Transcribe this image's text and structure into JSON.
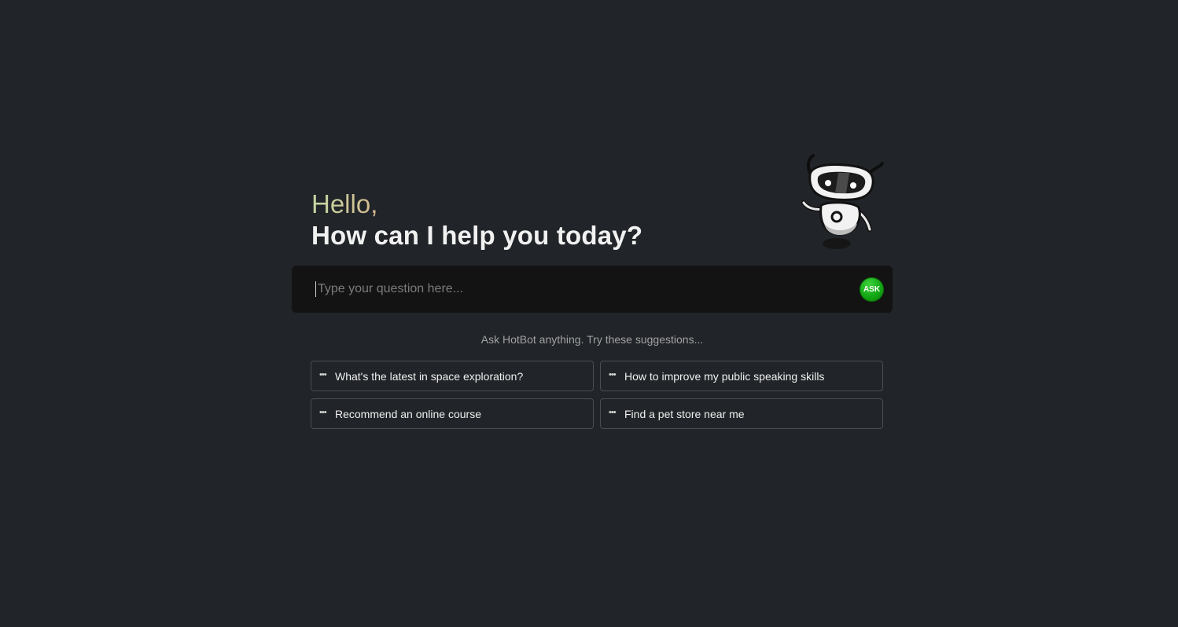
{
  "greeting": {
    "hello": "Hello,",
    "subtitle": "How can I help you today?"
  },
  "search": {
    "placeholder": "Type your question here...",
    "value": "",
    "ask_label": "ASK"
  },
  "hint": "Ask HotBot anything. Try these suggestions...",
  "suggestions": [
    {
      "icon": "more-dots-icon",
      "label": "What's the latest in space exploration?"
    },
    {
      "icon": "more-dots-icon",
      "label": "How to improve my public speaking skills"
    },
    {
      "icon": "more-dots-icon",
      "label": "Recommend an online course"
    },
    {
      "icon": "more-dots-icon",
      "label": "Find a pet store near me"
    }
  ],
  "colors": {
    "background": "#212428",
    "input_background": "#131313",
    "ask_button": "#13a613",
    "border": "#4a4d52"
  },
  "mascot": {
    "icon": "robot-mascot-icon"
  }
}
